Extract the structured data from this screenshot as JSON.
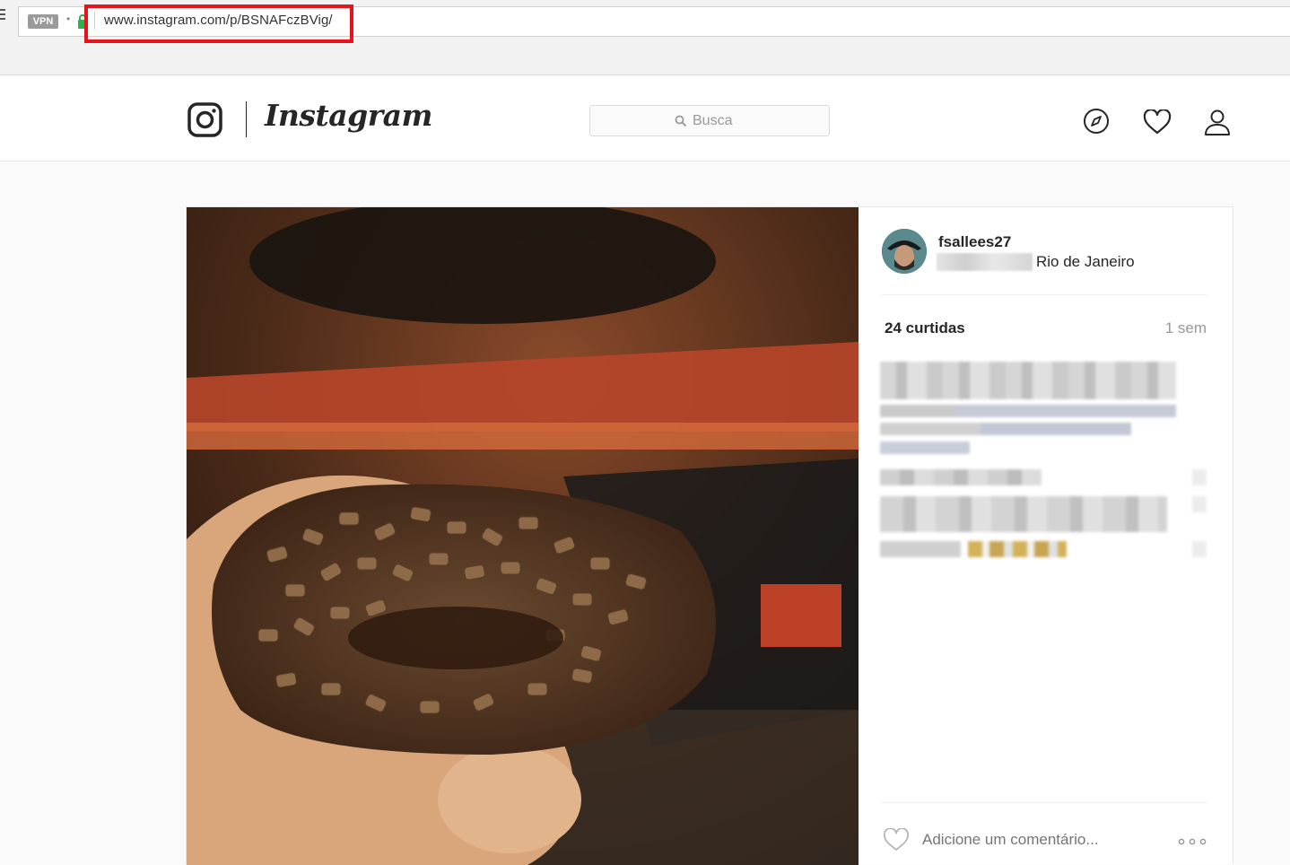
{
  "browser": {
    "vpn_badge": "VPN",
    "url": "www.instagram.com/p/BSNAFczBVig/"
  },
  "header": {
    "wordmark": "Instagram",
    "search_placeholder": "Busca",
    "icons": [
      "camera-icon",
      "explore-icon",
      "heart-icon",
      "profile-icon"
    ]
  },
  "post": {
    "username": "fsallees27",
    "location": "Rio de Janeiro",
    "likes": "24 curtidas",
    "time_ago": "1 sem",
    "comment_placeholder": "Adicione um comentário...",
    "more_icon": "more-options-icon"
  },
  "colors": {
    "highlight": "#e8141b",
    "text_primary": "#262626",
    "text_secondary": "#999999"
  }
}
